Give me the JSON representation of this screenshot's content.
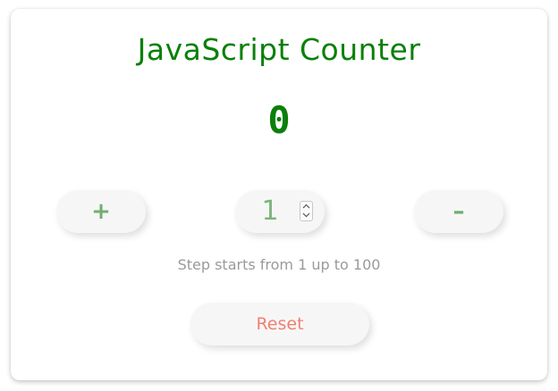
{
  "app": {
    "title": "JavaScript Counter"
  },
  "counter": {
    "value": "0"
  },
  "controls": {
    "increment_label": "+",
    "decrement_label": "–",
    "step_value": "1"
  },
  "hint": {
    "text": "Step starts from 1 up to 100"
  },
  "reset": {
    "label": "Reset"
  },
  "colors": {
    "title": "#0a800a",
    "count": "#0a800a",
    "button_sign": "#6fb06f",
    "step_value": "#7cb67c",
    "hint": "#9a9a9a",
    "reset_text": "#f08070",
    "pill_background": "#f7f6f6"
  }
}
